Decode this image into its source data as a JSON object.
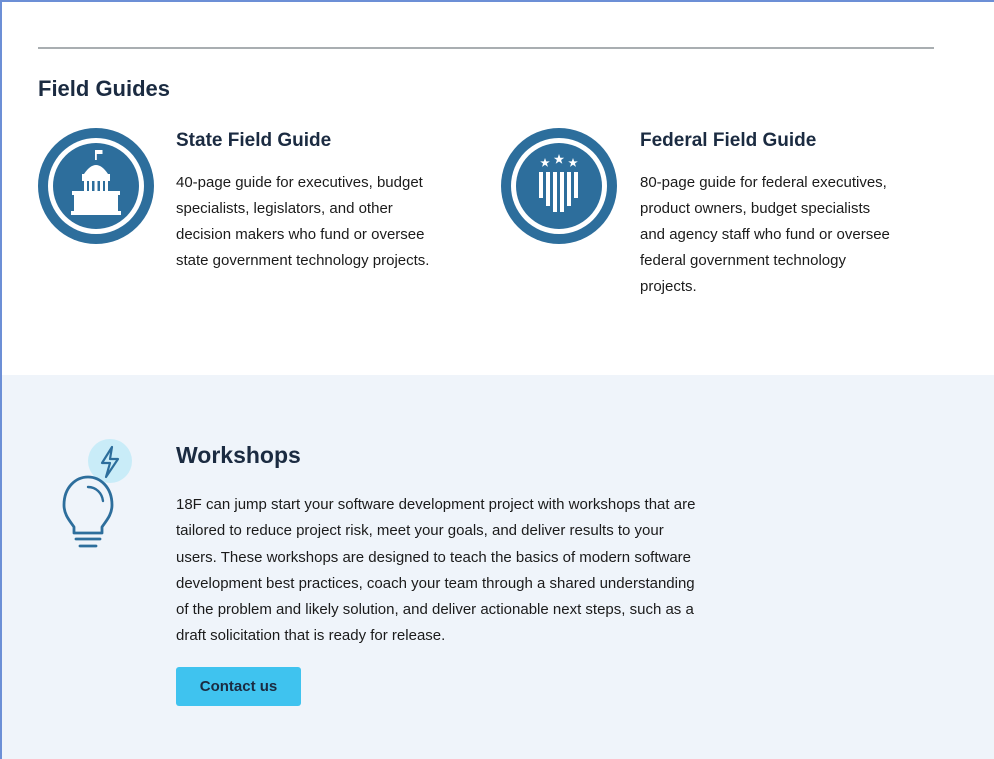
{
  "field_guides": {
    "title": "Field Guides",
    "guides": [
      {
        "heading": "State Field Guide",
        "desc_lines": [
          "40-page guide for executives, budget",
          "specialists, legislators, and other",
          "decision makers who fund or oversee",
          "state government technology projects."
        ],
        "icon": "capitol-building-icon"
      },
      {
        "heading": "Federal Field Guide",
        "desc_lines": [
          "80-page guide for federal executives,",
          "product owners, budget specialists",
          "and agency staff who fund or oversee",
          "federal government technology",
          "projects."
        ],
        "icon": "flag-shield-icon"
      }
    ]
  },
  "workshops": {
    "heading": "Workshops",
    "desc_lines": [
      "18F can jump start your software development project with workshops that are",
      "tailored to reduce project risk, meet your goals, and deliver results to your",
      "users. These workshops are designed to teach the basics of modern software",
      "development best practices, coach your team through a shared understanding",
      "of the problem and likely solution, and deliver actionable next steps, such as a",
      "draft solicitation that is ready for release."
    ],
    "button_label": "Contact us",
    "icon": "lightbulb-icon"
  },
  "colors": {
    "icon_blue": "#2d6e9c",
    "heading_navy": "#1b2b41",
    "workshop_bg": "#eff4fa",
    "button_bg": "#3fc3ef",
    "accent_light": "#c9ecf8"
  }
}
